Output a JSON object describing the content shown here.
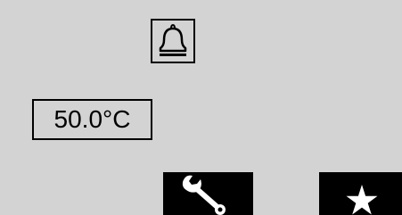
{
  "display": {
    "temperature": "50.0°C"
  },
  "icons": {
    "alarm": "bell-icon",
    "settings": "wrench-icon",
    "favorites": "star-icon"
  },
  "colors": {
    "background": "#d3d3d3",
    "foreground": "#000000",
    "key_background": "#000000",
    "key_icon": "#ffffff"
  }
}
